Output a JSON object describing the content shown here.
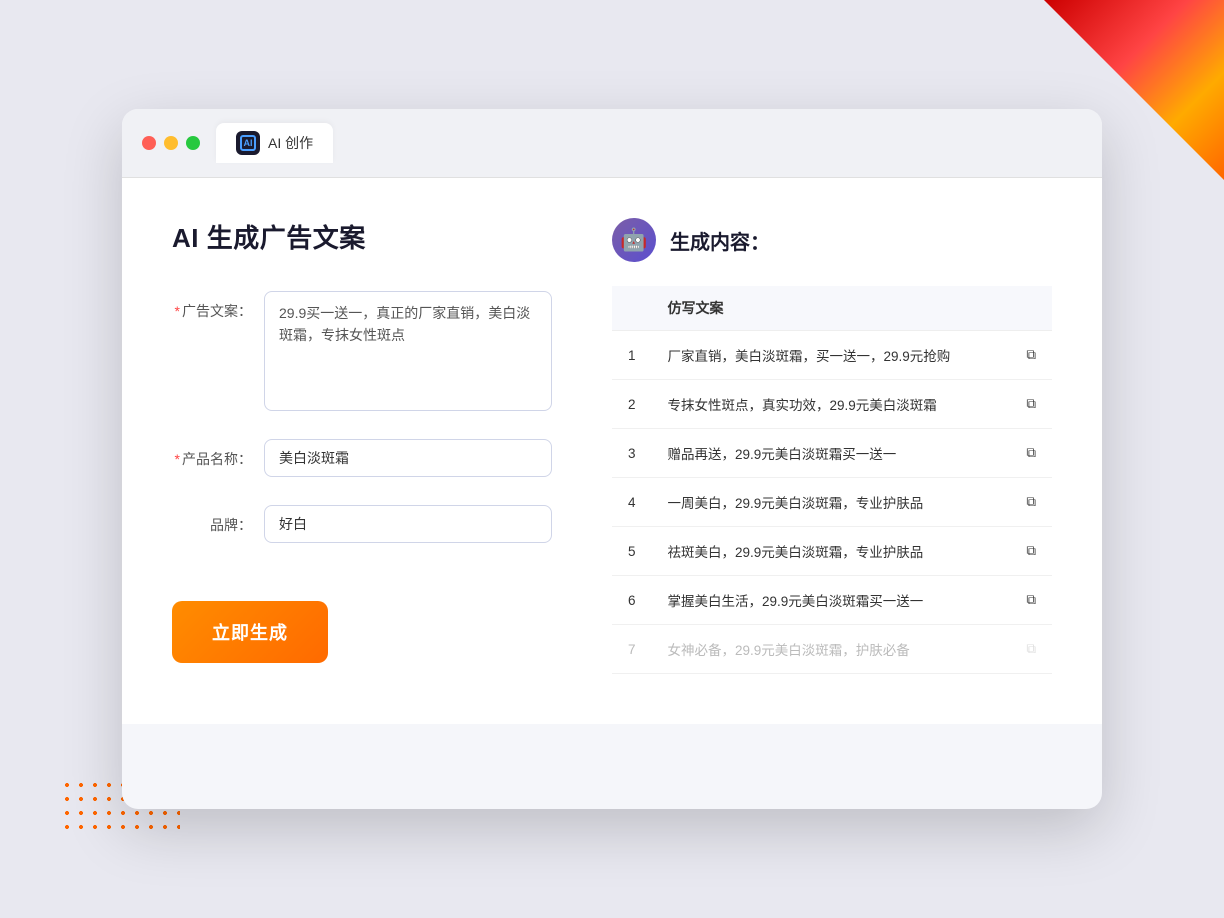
{
  "background": {
    "triangle_color": "red-orange"
  },
  "browser": {
    "tab_label": "AI 创作",
    "tab_icon_text": "AI"
  },
  "left_panel": {
    "title": "AI 生成广告文案",
    "form": {
      "ad_copy_label": "广告文案：",
      "ad_copy_required": "*",
      "ad_copy_value": "29.9买一送一，真正的厂家直销，美白淡斑霜，专抹女性斑点",
      "product_name_label": "产品名称：",
      "product_name_required": "*",
      "product_name_value": "美白淡斑霜",
      "brand_label": "品牌：",
      "brand_value": "好白"
    },
    "generate_btn_label": "立即生成"
  },
  "right_panel": {
    "header_title": "生成内容：",
    "table": {
      "column_header": "仿写文案",
      "rows": [
        {
          "num": "1",
          "text": "厂家直销，美白淡斑霜，买一送一，29.9元抢购"
        },
        {
          "num": "2",
          "text": "专抹女性斑点，真实功效，29.9元美白淡斑霜"
        },
        {
          "num": "3",
          "text": "赠品再送，29.9元美白淡斑霜买一送一"
        },
        {
          "num": "4",
          "text": "一周美白，29.9元美白淡斑霜，专业护肤品"
        },
        {
          "num": "5",
          "text": "祛斑美白，29.9元美白淡斑霜，专业护肤品"
        },
        {
          "num": "6",
          "text": "掌握美白生活，29.9元美白淡斑霜买一送一"
        },
        {
          "num": "7",
          "text": "女神必备，29.9元美白淡斑霜，护肤必备",
          "faded": true
        }
      ]
    }
  }
}
